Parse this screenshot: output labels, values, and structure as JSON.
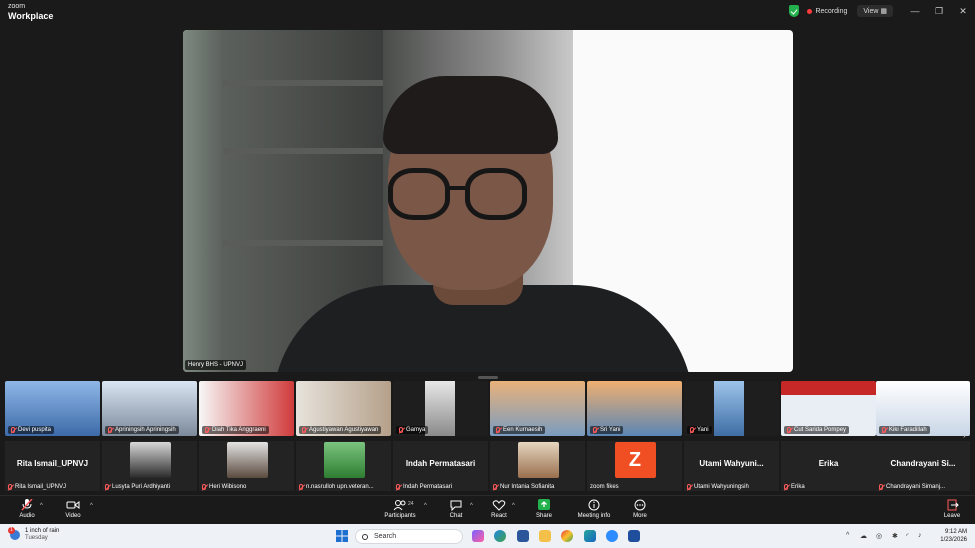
{
  "app": {
    "brand_line1": "zoom",
    "brand_line2": "Workplace"
  },
  "titlebar": {
    "recording": "Recording",
    "view": "View",
    "minimize": "—",
    "restore": "❐",
    "close": "✕"
  },
  "speaker": {
    "name": "Henry BHS - UPNVJ"
  },
  "video_strip": [
    {
      "name": "Devi puspita",
      "muted": true
    },
    {
      "name": "Apriningsih Apriningsih",
      "muted": true
    },
    {
      "name": "Diah Tika Anggraeni",
      "muted": true
    },
    {
      "name": "Agustiyawan Agustiyawan",
      "muted": true
    },
    {
      "name": "Gamya",
      "muted": true
    },
    {
      "name": "Een Kurnaesih",
      "muted": true
    },
    {
      "name": "Sri Yani",
      "muted": true
    },
    {
      "name": "Yani",
      "muted": true
    },
    {
      "name": "Cut Sarida Pompey",
      "muted": true
    },
    {
      "name": "Kiki Faradillah",
      "muted": true
    }
  ],
  "participant_row": [
    {
      "title": "Rita Ismail_UPNVJ",
      "label": "Rita Ismail_UPNVJ",
      "avatar": "none"
    },
    {
      "title": "",
      "label": "Lusyta Puri Ardhiyanti",
      "avatar": "photo"
    },
    {
      "title": "",
      "label": "Heri Wibisono",
      "avatar": "photo"
    },
    {
      "title": "",
      "label": "n.nasrulloh upn.veteran...",
      "avatar": "photo"
    },
    {
      "title": "Indah Permatasari",
      "label": "Indah Permatasari",
      "avatar": "none"
    },
    {
      "title": "",
      "label": "Nur Intania Sofianita",
      "avatar": "photo"
    },
    {
      "title": "",
      "label": "zoom fikes",
      "avatar": "letter",
      "letter": "Z"
    },
    {
      "title": "Utami Wahyuni...",
      "label": "Utami Wahyuningsih",
      "avatar": "none"
    },
    {
      "title": "Erika",
      "label": "Erika",
      "avatar": "none"
    },
    {
      "title": "Chandrayani Si...",
      "label": "Chandrayani Simanj...",
      "avatar": "none"
    }
  ],
  "toolbar": {
    "audio": "Audio",
    "video": "Video",
    "participants": "Participants",
    "participants_count": "24",
    "chat": "Chat",
    "react": "React",
    "share": "Share",
    "meeting_info": "Meeting info",
    "more": "More",
    "leave": "Leave"
  },
  "taskbar": {
    "weather_title": "1 inch of rain",
    "weather_sub": "Tuesday",
    "weather_badge": "1",
    "search_placeholder": "Search",
    "time": "9:12 AM",
    "date": "1/23/2026"
  },
  "colors": {
    "accent_red": "#ff5a5a",
    "share_green": "#22b14c",
    "zoom_orange": "#f04e23"
  }
}
